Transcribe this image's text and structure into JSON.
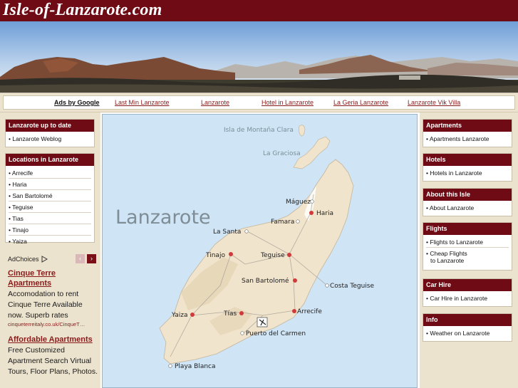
{
  "header": {
    "title": "Isle-of-Lanzarote.com"
  },
  "adbar": {
    "ads_label": "Ads by Google",
    "links": [
      "Last Min Lanzarote",
      "Lanzarote",
      "Hotel in Lanzarote",
      "La Geria Lanzarote",
      "Lanzarote Vik Villa"
    ]
  },
  "left": {
    "box1": {
      "title": "Lanzarote up to date",
      "items": [
        "• Lanzarote Weblog"
      ]
    },
    "box2": {
      "title": "Locations in Lanzarote",
      "items": [
        "• Arrecife",
        "• Haria",
        "• San Bartolomé",
        "• Teguise",
        "• Tias",
        "• Tinajo",
        "• Yaiza"
      ]
    },
    "adchoices": {
      "label": "AdChoices"
    },
    "ad1": {
      "title_line1": "Cinque Terre",
      "title_line2": "Apartments",
      "text": "Accomodation to rent Cinque Terre Available now. Superb rates",
      "url": "cinqueterreitaly.co.uk/CinqueT…"
    },
    "ad2": {
      "title": "Affordable Apartments",
      "text": "Free Customized Apartment Search Virtual Tours, Floor Plans, Photos."
    }
  },
  "right": {
    "boxes": [
      {
        "title": "Apartments",
        "items": [
          "• Apartments Lanzarote"
        ]
      },
      {
        "title": "Hotels",
        "items": [
          "• Hotels in Lanzarote"
        ]
      },
      {
        "title": "About this Isle",
        "items": [
          "• About Lanzarote"
        ]
      },
      {
        "title": "Flights",
        "items": [
          "• Flights to Lanzarote",
          "• Cheap Flights",
          "to Lanzarote"
        ]
      },
      {
        "title": "Car Hire",
        "items": [
          "• Car Hire in Lanzarote"
        ]
      },
      {
        "title": "Info",
        "items": [
          "• Weather on Lanzarote"
        ]
      }
    ]
  },
  "map": {
    "title": "Lanzarote",
    "islands": [
      "Isla de Montaña Clara",
      "La Graciosa"
    ],
    "towns": [
      "Máguez",
      "Haria",
      "Famara",
      "La Santa",
      "Tinajo",
      "Teguise",
      "San Bartolomé",
      "Costa Teguise",
      "Yaiza",
      "Tías",
      "Arrecife",
      "Puerto del Carmen",
      "Playa Blanca"
    ],
    "colors": {
      "sea": "#cfe4f5",
      "land": "#f1e4cc",
      "town": "#d13a3a",
      "brand": "#6e0b14"
    }
  }
}
